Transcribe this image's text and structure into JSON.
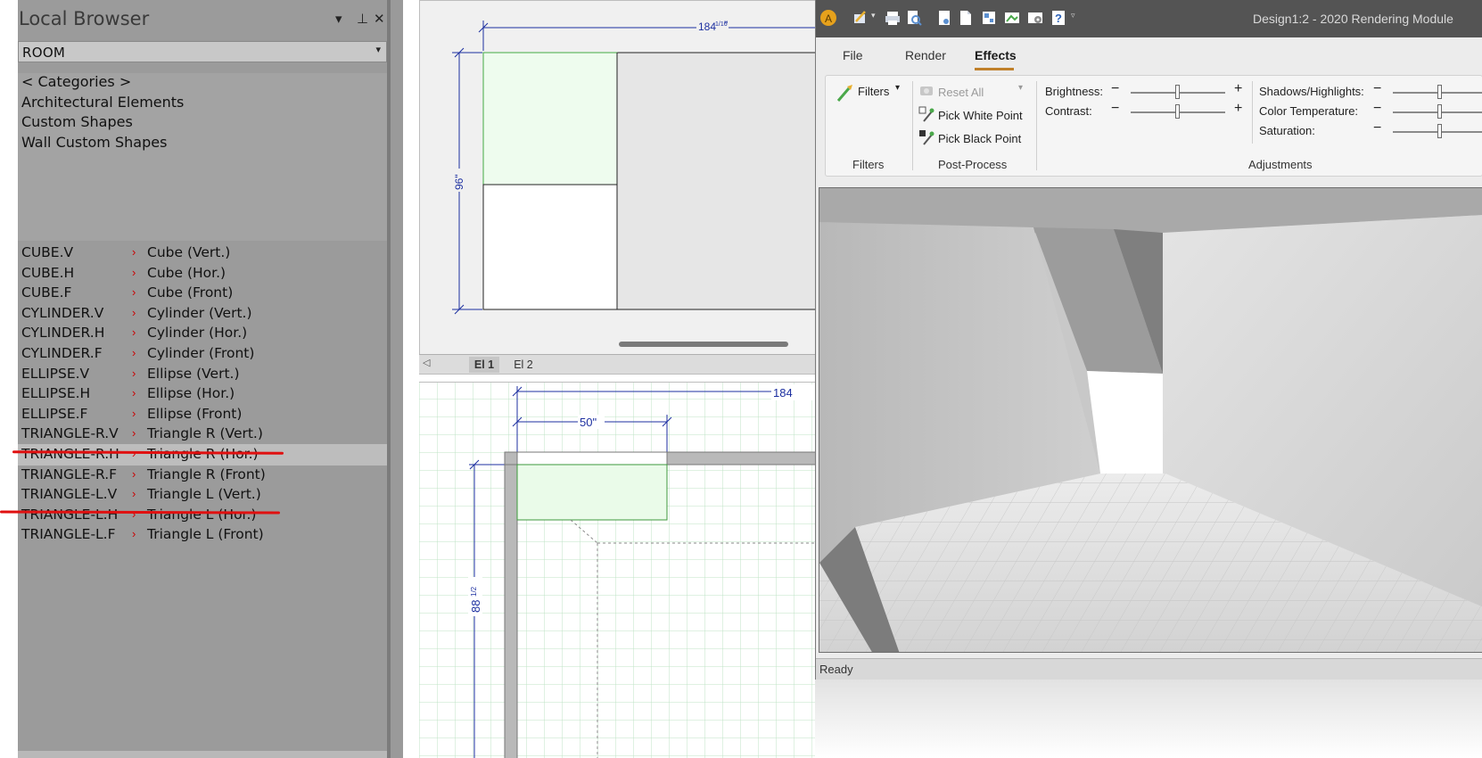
{
  "local_browser": {
    "title": "Local Browser",
    "controls": {
      "dropdown": "▾",
      "pin": "⊥",
      "close": "✕"
    },
    "library_select": "ROOM",
    "categories": [
      "< Categories >",
      "Architectural Elements",
      "Custom Shapes",
      "Wall Custom Shapes"
    ],
    "items": [
      {
        "code": "CUBE.V",
        "desc": "Cube (Vert.)"
      },
      {
        "code": "CUBE.H",
        "desc": "Cube (Hor.)"
      },
      {
        "code": "CUBE.F",
        "desc": "Cube (Front)"
      },
      {
        "code": "CYLINDER.V",
        "desc": "Cylinder (Vert.)"
      },
      {
        "code": "CYLINDER.H",
        "desc": "Cylinder (Hor.)"
      },
      {
        "code": "CYLINDER.F",
        "desc": "Cylinder (Front)"
      },
      {
        "code": "ELLIPSE.V",
        "desc": "Ellipse (Vert.)"
      },
      {
        "code": "ELLIPSE.H",
        "desc": "Ellipse (Hor.)"
      },
      {
        "code": "ELLIPSE.F",
        "desc": "Ellipse (Front)"
      },
      {
        "code": "TRIANGLE-R.V",
        "desc": "Triangle R (Vert.)"
      },
      {
        "code": "TRIANGLE-R.H",
        "desc": "Triangle R (Hor.)"
      },
      {
        "code": "TRIANGLE-R.F",
        "desc": "Triangle R (Front)"
      },
      {
        "code": "TRIANGLE-L.V",
        "desc": "Triangle L (Vert.)"
      },
      {
        "code": "TRIANGLE-L.H",
        "desc": "Triangle L (Hor.)"
      },
      {
        "code": "TRIANGLE-L.F",
        "desc": "Triangle L (Front)"
      }
    ],
    "selected_item": "TRIANGLE-R.H"
  },
  "elevation_view": {
    "dim_width": "184",
    "dim_width_fraction": "1/16",
    "dim_height": "96\"",
    "tabs": [
      "El 1",
      "El 2"
    ],
    "active_tab": "El 1"
  },
  "plan_view": {
    "dim_width": "184",
    "dim_segment": "50\"",
    "dim_depth": "88",
    "dim_depth_fraction": "1/2"
  },
  "rendering_module": {
    "title": "Design1:2 - 2020 Rendering Module",
    "menu": [
      "File",
      "Render",
      "Effects"
    ],
    "active_menu": "Effects",
    "filters_button": "Filters",
    "reset_all": "Reset All",
    "pick_white": "Pick White Point",
    "pick_black": "Pick Black Point",
    "groups": {
      "filters": "Filters",
      "post_process": "Post-Process",
      "adjustments": "Adjustments"
    },
    "sliders": {
      "brightness": "Brightness:",
      "contrast": "Contrast:",
      "shadows": "Shadows/Highlights:",
      "color_temp": "Color Temperature:",
      "saturation": "Saturation:"
    },
    "status": "Ready"
  },
  "colors": {
    "annotation_red": "#e01010",
    "dimension_blue": "#1c2fa0",
    "accent": "#c0802a"
  }
}
